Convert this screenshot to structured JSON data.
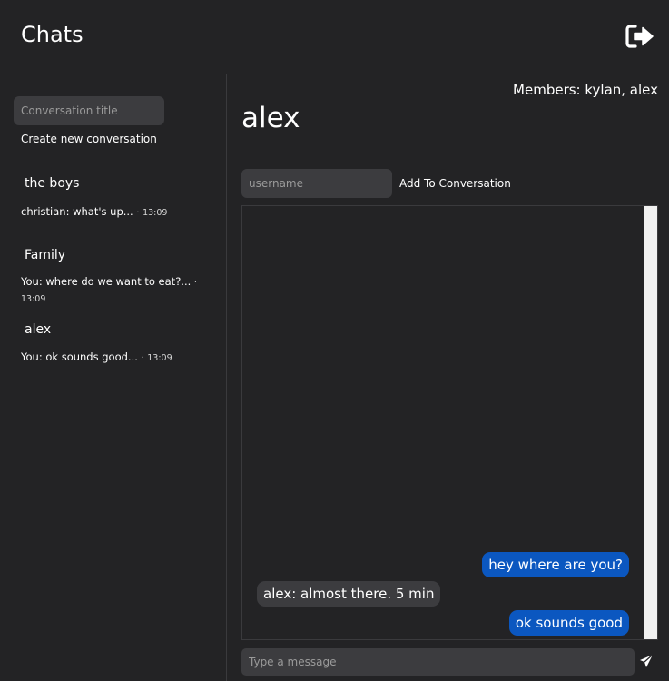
{
  "header": {
    "title": "Chats",
    "logout_icon": "sign-out-icon"
  },
  "sidebar": {
    "title_input": {
      "placeholder": "Conversation title",
      "value": ""
    },
    "create_label": "Create new conversation",
    "conversations": [
      {
        "name": "the boys",
        "preview": "christian: what's up...",
        "time": "13:09"
      },
      {
        "name": "Family",
        "preview": "You: where do we want to eat?...",
        "time": "13:09"
      },
      {
        "name": "alex",
        "preview": "You: ok sounds good...",
        "time": "13:09"
      }
    ],
    "separator": "·"
  },
  "conversation": {
    "members": "Members: kylan, alex",
    "title": "alex",
    "username_input": {
      "placeholder": "username",
      "value": ""
    },
    "add_label": "Add To Conversation",
    "messages": [
      {
        "from": "me",
        "text": "hey where are you?"
      },
      {
        "from": "them",
        "text": "alex: almost there. 5 min"
      },
      {
        "from": "me",
        "text": "ok sounds good"
      }
    ],
    "message_input": {
      "placeholder": "Type a message",
      "value": ""
    },
    "send_icon": "paper-plane-icon"
  },
  "colors": {
    "background": "#232325",
    "input_bg": "#3c3c3f",
    "my_bubble": "#0b57c0",
    "their_bubble": "#3c3c3f",
    "divider": "#3a3a3d"
  }
}
